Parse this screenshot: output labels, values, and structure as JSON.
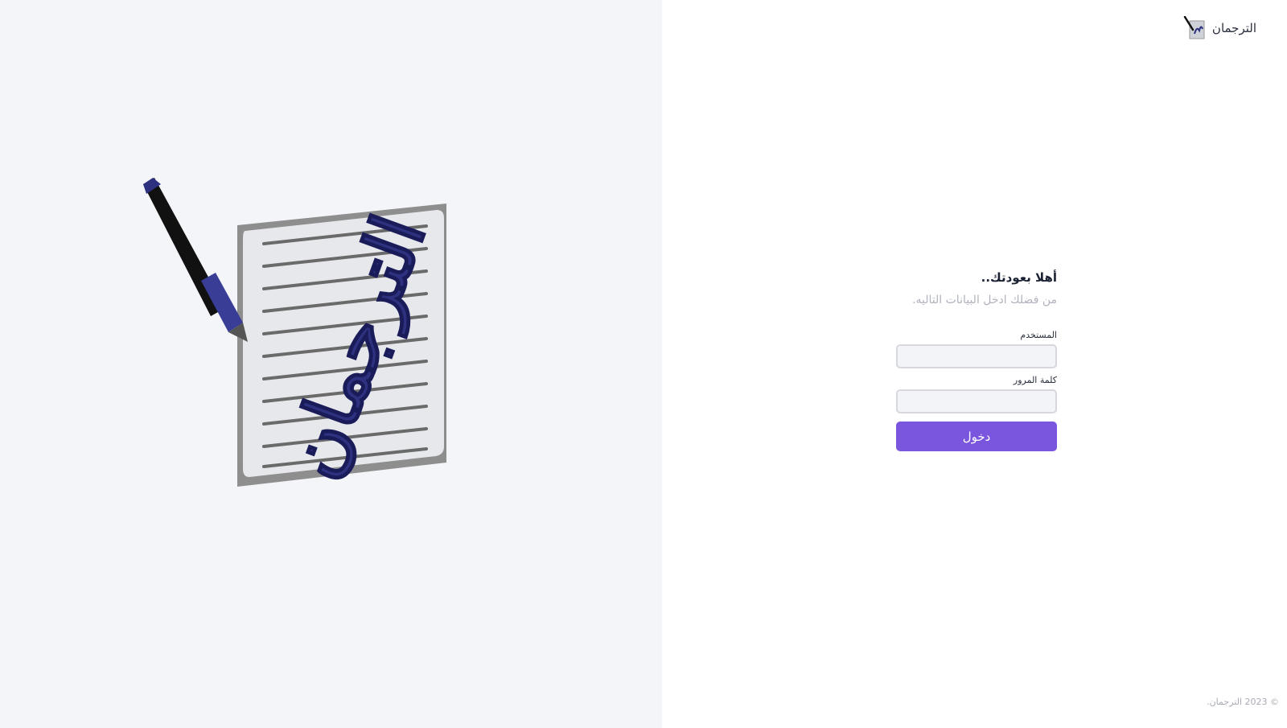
{
  "brand": {
    "name": "الترجمان",
    "logo_icon": "translator-logo-icon"
  },
  "illustration": {
    "logo_text": "الترجمان",
    "icon": "pen-and-paper-illustration",
    "accent_color": "#2e3180"
  },
  "login": {
    "greeting": "أهلا بعودتك..",
    "subtitle": "من فضلك ادخل البيانات التاليه.",
    "username_label": "المستخدم",
    "username_value": "",
    "password_label": "كلمة المرور",
    "password_value": "",
    "submit_label": "دخول"
  },
  "footer": {
    "copyright": "© 2023 الترجمان."
  },
  "colors": {
    "left_panel_bg": "#f3f5f9",
    "button_bg": "#7a55dd",
    "input_bg": "#f3f4f7"
  }
}
